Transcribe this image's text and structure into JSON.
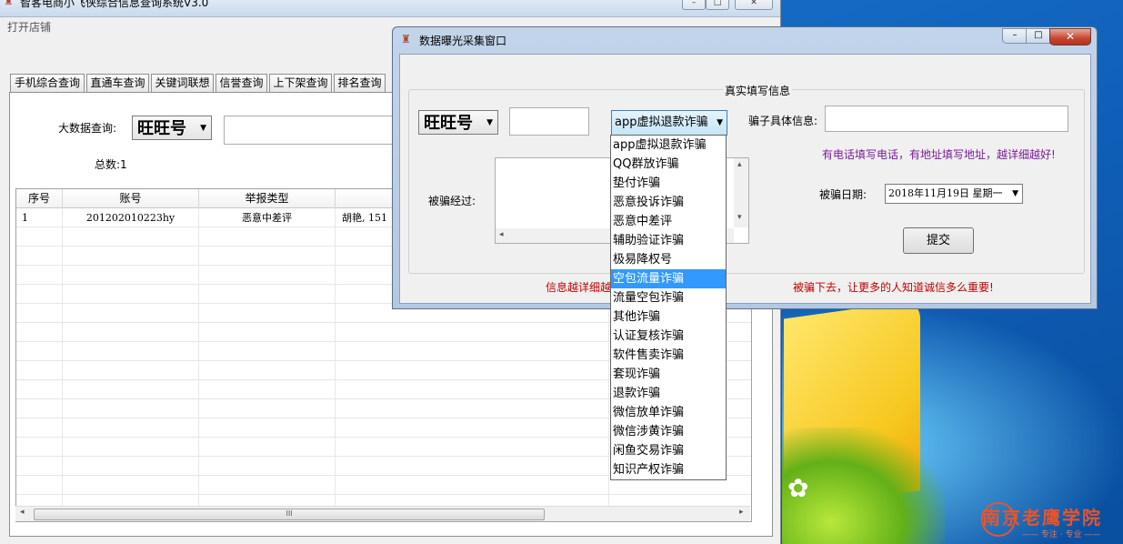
{
  "main_window": {
    "title": "智客电商小飞侠综合信息查询系统V3.0",
    "menu": {
      "open_store": "打开店铺"
    },
    "tabs": [
      "手机综合查询",
      "直通车查询",
      "关键词联想",
      "信誉查询",
      "上下架查询",
      "排名查询"
    ],
    "bigdata": {
      "label": "大数据查询:",
      "type": "旺旺号",
      "total_label": "总数:1"
    },
    "grid": {
      "columns": [
        "序号",
        "账号",
        "举报类型"
      ],
      "rows": [
        {
          "index": "1",
          "account": "201202010223hy",
          "type": "恶意中差评",
          "detail": "胡艳, 151"
        }
      ]
    },
    "scroll_grip": "III"
  },
  "dialog": {
    "title": "数据曝光采集窗口",
    "group_title": "真实填写信息",
    "id_type": "旺旺号",
    "fraud_type": "app虚拟退款诈骗",
    "fraud_info_label": "骗子具体信息:",
    "hint": "有电话填写电话，有地址填写地址，越详细越好!",
    "process_label": "被骗经过:",
    "date_label": "被骗日期:",
    "date_value": "2018年11月19日  星期一",
    "submit": "提交",
    "warning_left": "信息越详细越",
    "warning_right": "被骗下去，让更多的人知道诚信多么重要!"
  },
  "dropdown": {
    "selected_index": 7,
    "options": [
      "app虚拟退款诈骗",
      "QQ群放诈骗",
      "垫付诈骗",
      "恶意投诉诈骗",
      "恶意中差评",
      "辅助验证诈骗",
      "极易降权号",
      "空包流量诈骗",
      "流量空包诈骗",
      "其他诈骗",
      "认证复核诈骗",
      "软件售卖诈骗",
      "套现诈骗",
      "退款诈骗",
      "微信放单诈骗",
      "微信涉黄诈骗",
      "闲鱼交易诈骗",
      "知识产权诈骗"
    ]
  },
  "watermark": {
    "text": "南京老鹰学院",
    "sub": "—— 专注 · 专业 ——"
  },
  "colors": {
    "selection": "#3399ff",
    "warning": "#c00000",
    "hint": "#7a1b9b"
  }
}
